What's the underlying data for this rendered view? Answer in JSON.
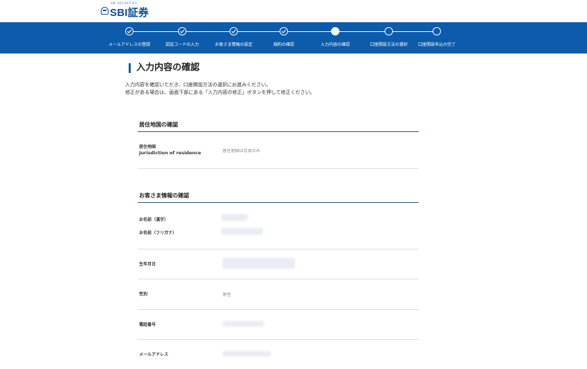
{
  "brand": {
    "logo_sub": "SBI証券 ロゴ",
    "logo_text": "SBI証券"
  },
  "colors": {
    "band": "#0d5cab",
    "accent": "#0d5cab",
    "divider": "#2b4e7c"
  },
  "progress": {
    "current_index": 4,
    "steps": [
      {
        "label": "メールアドレスの登録",
        "state": "done"
      },
      {
        "label": "認証コードの入力",
        "state": "done"
      },
      {
        "label": "お客さま情報の設定",
        "state": "done"
      },
      {
        "label": "規約の確認",
        "state": "done"
      },
      {
        "label": "入力内容の確認",
        "state": "current"
      },
      {
        "label": "口座開設方法の選択",
        "state": "todo"
      },
      {
        "label": "口座開設申込の完了",
        "state": "todo"
      }
    ]
  },
  "page": {
    "title": "入力内容の確認",
    "intro_line1": "入力内容を確認いただき、口座開設方法の選択にお進みください。",
    "intro_line2": "修正がある場合は、画面下部にある「入力内容の修正」ボタンを押して修正ください。"
  },
  "residence": {
    "title": "居住地国の確認",
    "label_jp": "居住地国",
    "label_en": "Jurisdiction of residence",
    "value": "居住地国は日本のみ"
  },
  "customer": {
    "title": "お客さま情報の確認",
    "name_kanji_label": "お名前（漢字）",
    "name_kana_label": "お名前（フリガナ）",
    "birthdate_label": "生年月日",
    "gender_label": "性別",
    "gender_value": "男性",
    "phone_label": "電話番号",
    "email_label": "メールアドレス"
  }
}
